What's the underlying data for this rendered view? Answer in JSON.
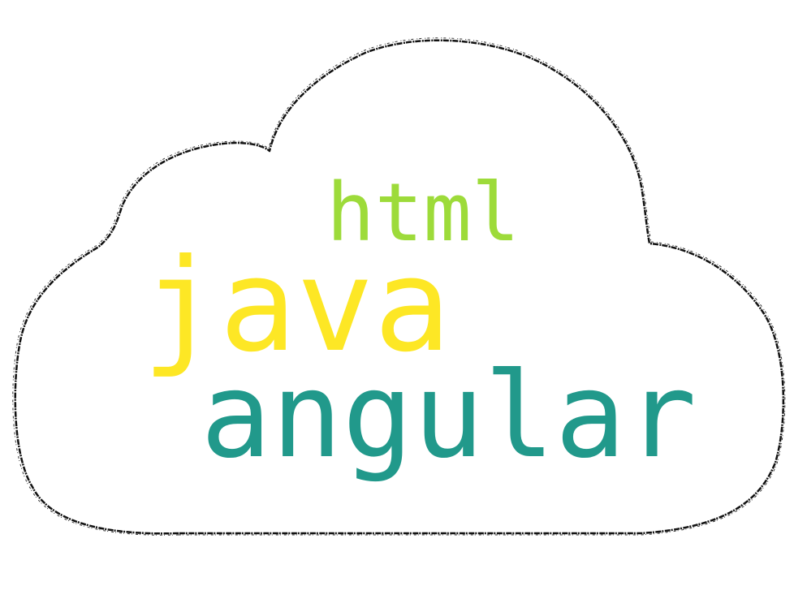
{
  "words": [
    {
      "text": "html",
      "color": "#9ddb3a"
    },
    {
      "text": "java",
      "color": "#fde725"
    },
    {
      "text": "angular",
      "color": "#21998b"
    }
  ],
  "shape": "cloud",
  "background_color": "#ffffff",
  "outline_color": "#111111"
}
